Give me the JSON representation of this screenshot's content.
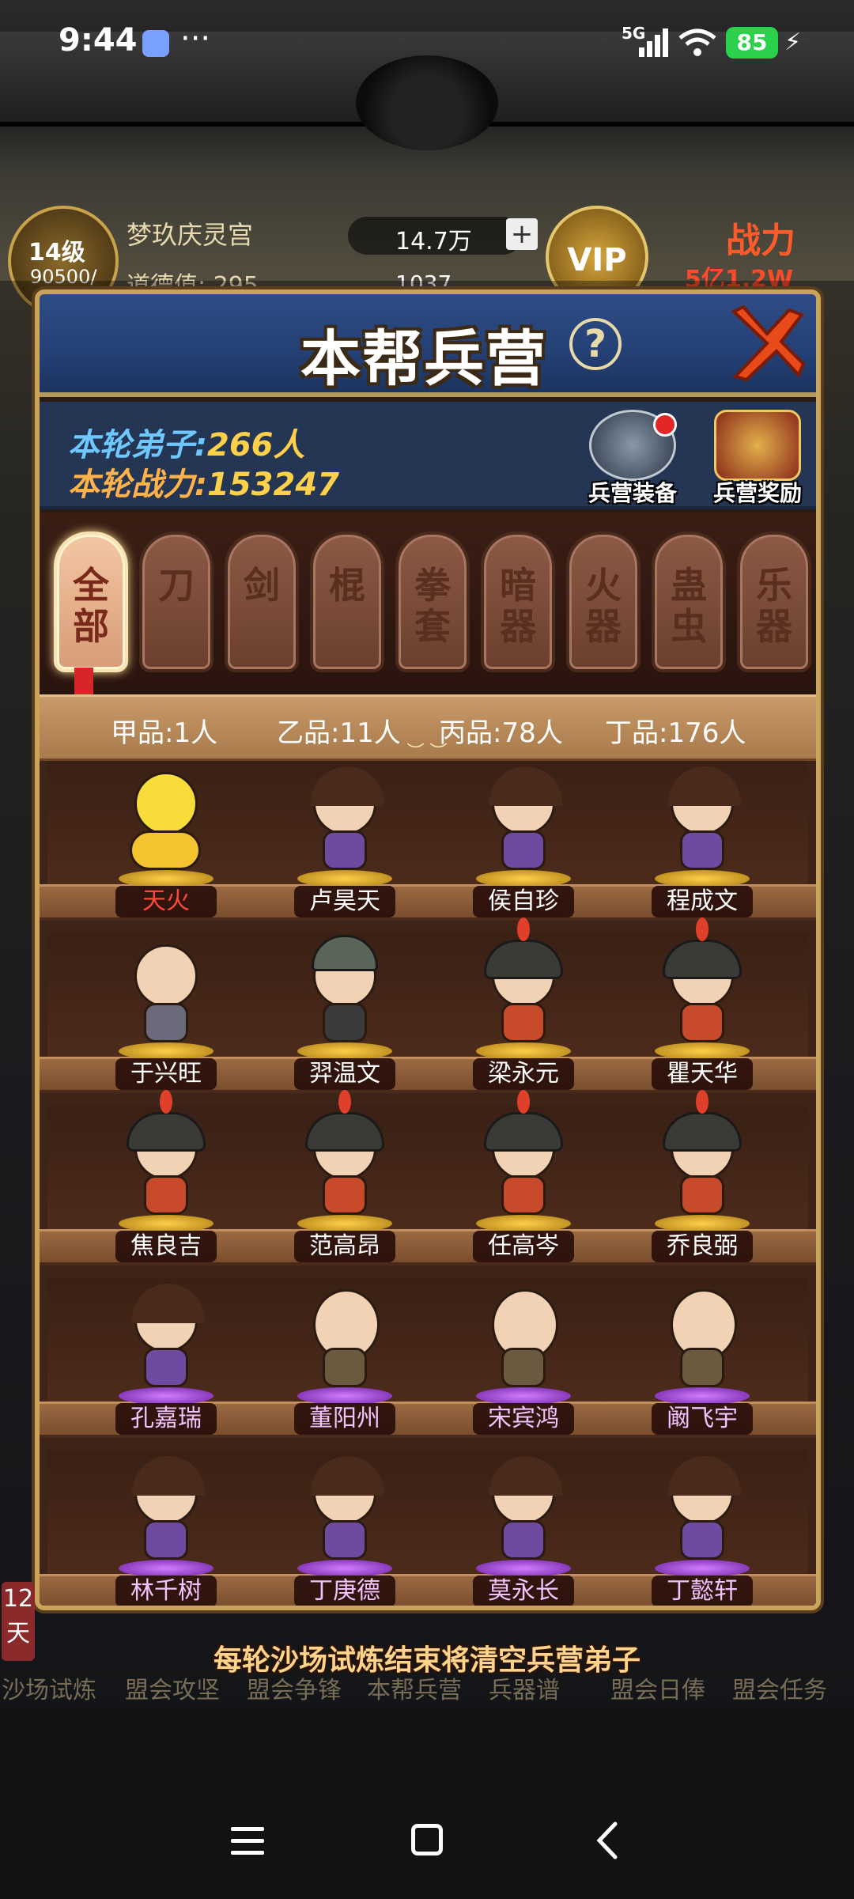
{
  "status_bar": {
    "time": "9:44",
    "dots": "···",
    "network": "5G",
    "battery": "85",
    "charging_icon": "bolt-icon"
  },
  "hud": {
    "level": "14级",
    "exp": "90500/",
    "name": "梦玖庆灵宫",
    "virtue": "道德值: 295",
    "silver": "14.7万",
    "gold": "1037",
    "vip": "VIP",
    "power_label": "战力",
    "power_value": "5亿1.2W"
  },
  "modal": {
    "title": "本帮兵营",
    "help_label": "?",
    "info": {
      "disciples_label": "本轮弟子:",
      "disciples_value": "266人",
      "power_label": "本轮战力:",
      "power_value": "153247"
    },
    "buttons": {
      "equip": "兵营装备",
      "reward": "兵营奖励"
    },
    "tabs": [
      "全部",
      "刀",
      "剑",
      "棍",
      "拳套",
      "暗器",
      "火器",
      "蛊虫",
      "乐器"
    ],
    "grades": {
      "a": "甲品:1人",
      "b": "乙品:11人",
      "c": "丙品:78人",
      "d": "丁品:176人"
    },
    "characters": [
      [
        "天火",
        "卢昊天",
        "侯自珍",
        "程成文"
      ],
      [
        "于兴旺",
        "羿温文",
        "梁永元",
        "瞿天华"
      ],
      [
        "焦良吉",
        "范高昂",
        "任高岑",
        "乔良弼"
      ],
      [
        "孔嘉瑞",
        "董阳州",
        "宋宾鸿",
        "阚飞宇"
      ],
      [
        "林千树",
        "丁庚德",
        "莫永长",
        "丁懿轩"
      ]
    ]
  },
  "footer_note": "每轮沙场试炼结束将清空兵营弟子",
  "bottom_nav": {
    "days": "12天",
    "items": [
      "沙场试炼",
      "盟会攻坚",
      "盟会争锋",
      "本帮兵营",
      "兵器谱",
      "盟会日俸",
      "盟会任务"
    ]
  }
}
